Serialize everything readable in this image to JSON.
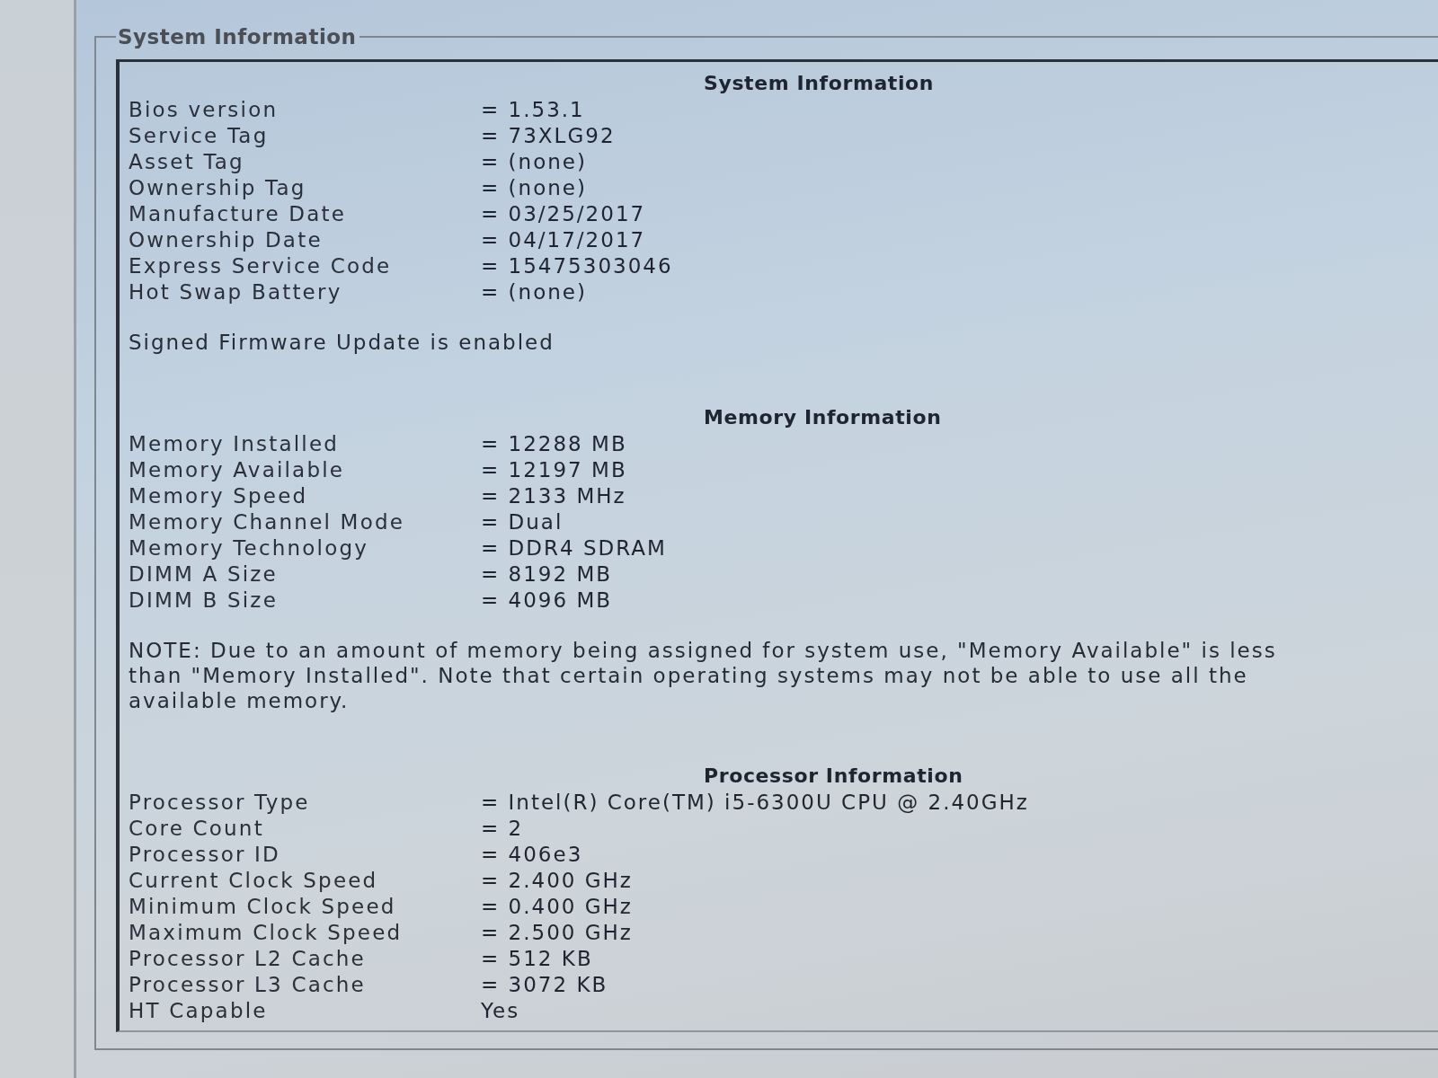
{
  "group_title": "System Information",
  "sections": [
    {
      "heading": "System Information",
      "rows": [
        {
          "label": "Bios version",
          "value": "= 1.53.1"
        },
        {
          "label": "Service Tag",
          "value": "= 73XLG92"
        },
        {
          "label": "Asset Tag",
          "value": "= (none)"
        },
        {
          "label": "Ownership Tag",
          "value": "= (none)"
        },
        {
          "label": "Manufacture Date",
          "value": "= 03/25/2017"
        },
        {
          "label": "Ownership Date",
          "value": "= 04/17/2017"
        },
        {
          "label": "Express Service Code",
          "value": "= 15475303046"
        },
        {
          "label": "Hot Swap Battery",
          "value": "= (none)"
        }
      ],
      "note": "Signed Firmware Update is enabled"
    },
    {
      "heading": "Memory Information",
      "rows": [
        {
          "label": "Memory Installed",
          "value": "= 12288 MB"
        },
        {
          "label": "Memory Available",
          "value": "= 12197 MB"
        },
        {
          "label": "Memory Speed",
          "value": "= 2133 MHz"
        },
        {
          "label": "Memory Channel Mode",
          "value": "= Dual"
        },
        {
          "label": "Memory Technology",
          "value": "= DDR4 SDRAM"
        },
        {
          "label": "DIMM A Size",
          "value": "= 8192 MB"
        },
        {
          "label": "DIMM B Size",
          "value": "= 4096 MB"
        }
      ],
      "note": "NOTE: Due to an amount of memory being assigned for system use, \"Memory Available\" is less than \"Memory Installed\". Note that certain operating systems may not be able to use all the available memory."
    },
    {
      "heading": "Processor Information",
      "rows": [
        {
          "label": "Processor Type",
          "value": "= Intel(R) Core(TM) i5-6300U CPU @ 2.40GHz"
        },
        {
          "label": "Core Count",
          "value": "= 2"
        },
        {
          "label": "Processor ID",
          "value": "= 406e3"
        },
        {
          "label": "Current Clock Speed",
          "value": "= 2.400 GHz"
        },
        {
          "label": "Minimum Clock Speed",
          "value": "= 0.400 GHz"
        },
        {
          "label": "Maximum Clock Speed",
          "value": "= 2.500 GHz"
        },
        {
          "label": "Processor L2 Cache",
          "value": "= 512 KB"
        },
        {
          "label": "Processor L3 Cache",
          "value": "= 3072 KB"
        },
        {
          "label": "HT Capable",
          "value": "Yes"
        }
      ]
    }
  ]
}
